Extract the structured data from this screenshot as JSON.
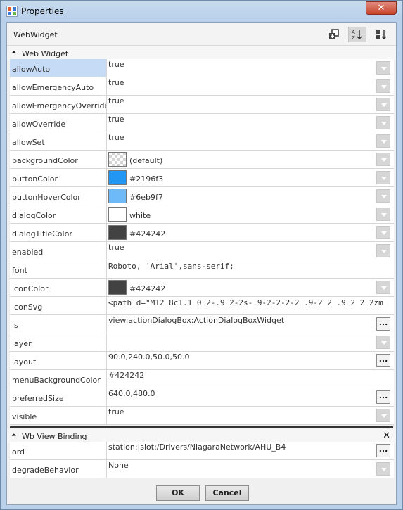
{
  "window": {
    "title": "Properties",
    "close_label": "✕"
  },
  "header": {
    "title": "WebWidget"
  },
  "sections": {
    "web_widget": {
      "label": "Web Widget"
    },
    "wb_view_binding": {
      "label": "Wb View Binding"
    }
  },
  "properties": [
    {
      "name": "allowAuto",
      "value": "true"
    },
    {
      "name": "allowEmergencyAuto",
      "value": "true"
    },
    {
      "name": "allowEmergencyOverride",
      "value": "true"
    },
    {
      "name": "allowOverride",
      "value": "true"
    },
    {
      "name": "allowSet",
      "value": "true"
    },
    {
      "name": "backgroundColor",
      "value": "(default)",
      "color": "transparent"
    },
    {
      "name": "buttonColor",
      "value": "#2196f3",
      "color": "#2196f3"
    },
    {
      "name": "buttonHoverColor",
      "value": "#6eb9f7",
      "color": "#6eb9f7"
    },
    {
      "name": "dialogColor",
      "value": "white",
      "color": "#ffffff"
    },
    {
      "name": "dialogTitleColor",
      "value": "#424242",
      "color": "#424242"
    },
    {
      "name": "enabled",
      "value": "true"
    },
    {
      "name": "font",
      "value": "Roboto, 'Arial',sans-serif;"
    },
    {
      "name": "iconColor",
      "value": "#424242",
      "color": "#424242"
    },
    {
      "name": "iconSvg",
      "value": "<path d=\"M12 8c1.1 0 2-.9 2-2s-.9-2-2-2-2 .9-2 2 .9 2 2 2zm"
    },
    {
      "name": "js",
      "value": "view:actionDialogBox:ActionDialogBoxWidget"
    },
    {
      "name": "layer",
      "value": ""
    },
    {
      "name": "layout",
      "value": "90.0,240.0,50.0,50.0"
    },
    {
      "name": "menuBackgroundColor",
      "value": "#424242"
    },
    {
      "name": "preferredSize",
      "value": "640.0,480.0"
    },
    {
      "name": "visible",
      "value": "true"
    }
  ],
  "binding": [
    {
      "name": "ord",
      "value": "station:|slot:/Drivers/NiagaraNetwork/AHU_B4"
    },
    {
      "name": "degradeBehavior",
      "value": "None"
    }
  ],
  "buttons": {
    "ok": "OK",
    "cancel": "Cancel"
  },
  "ellipsis_label": "..."
}
